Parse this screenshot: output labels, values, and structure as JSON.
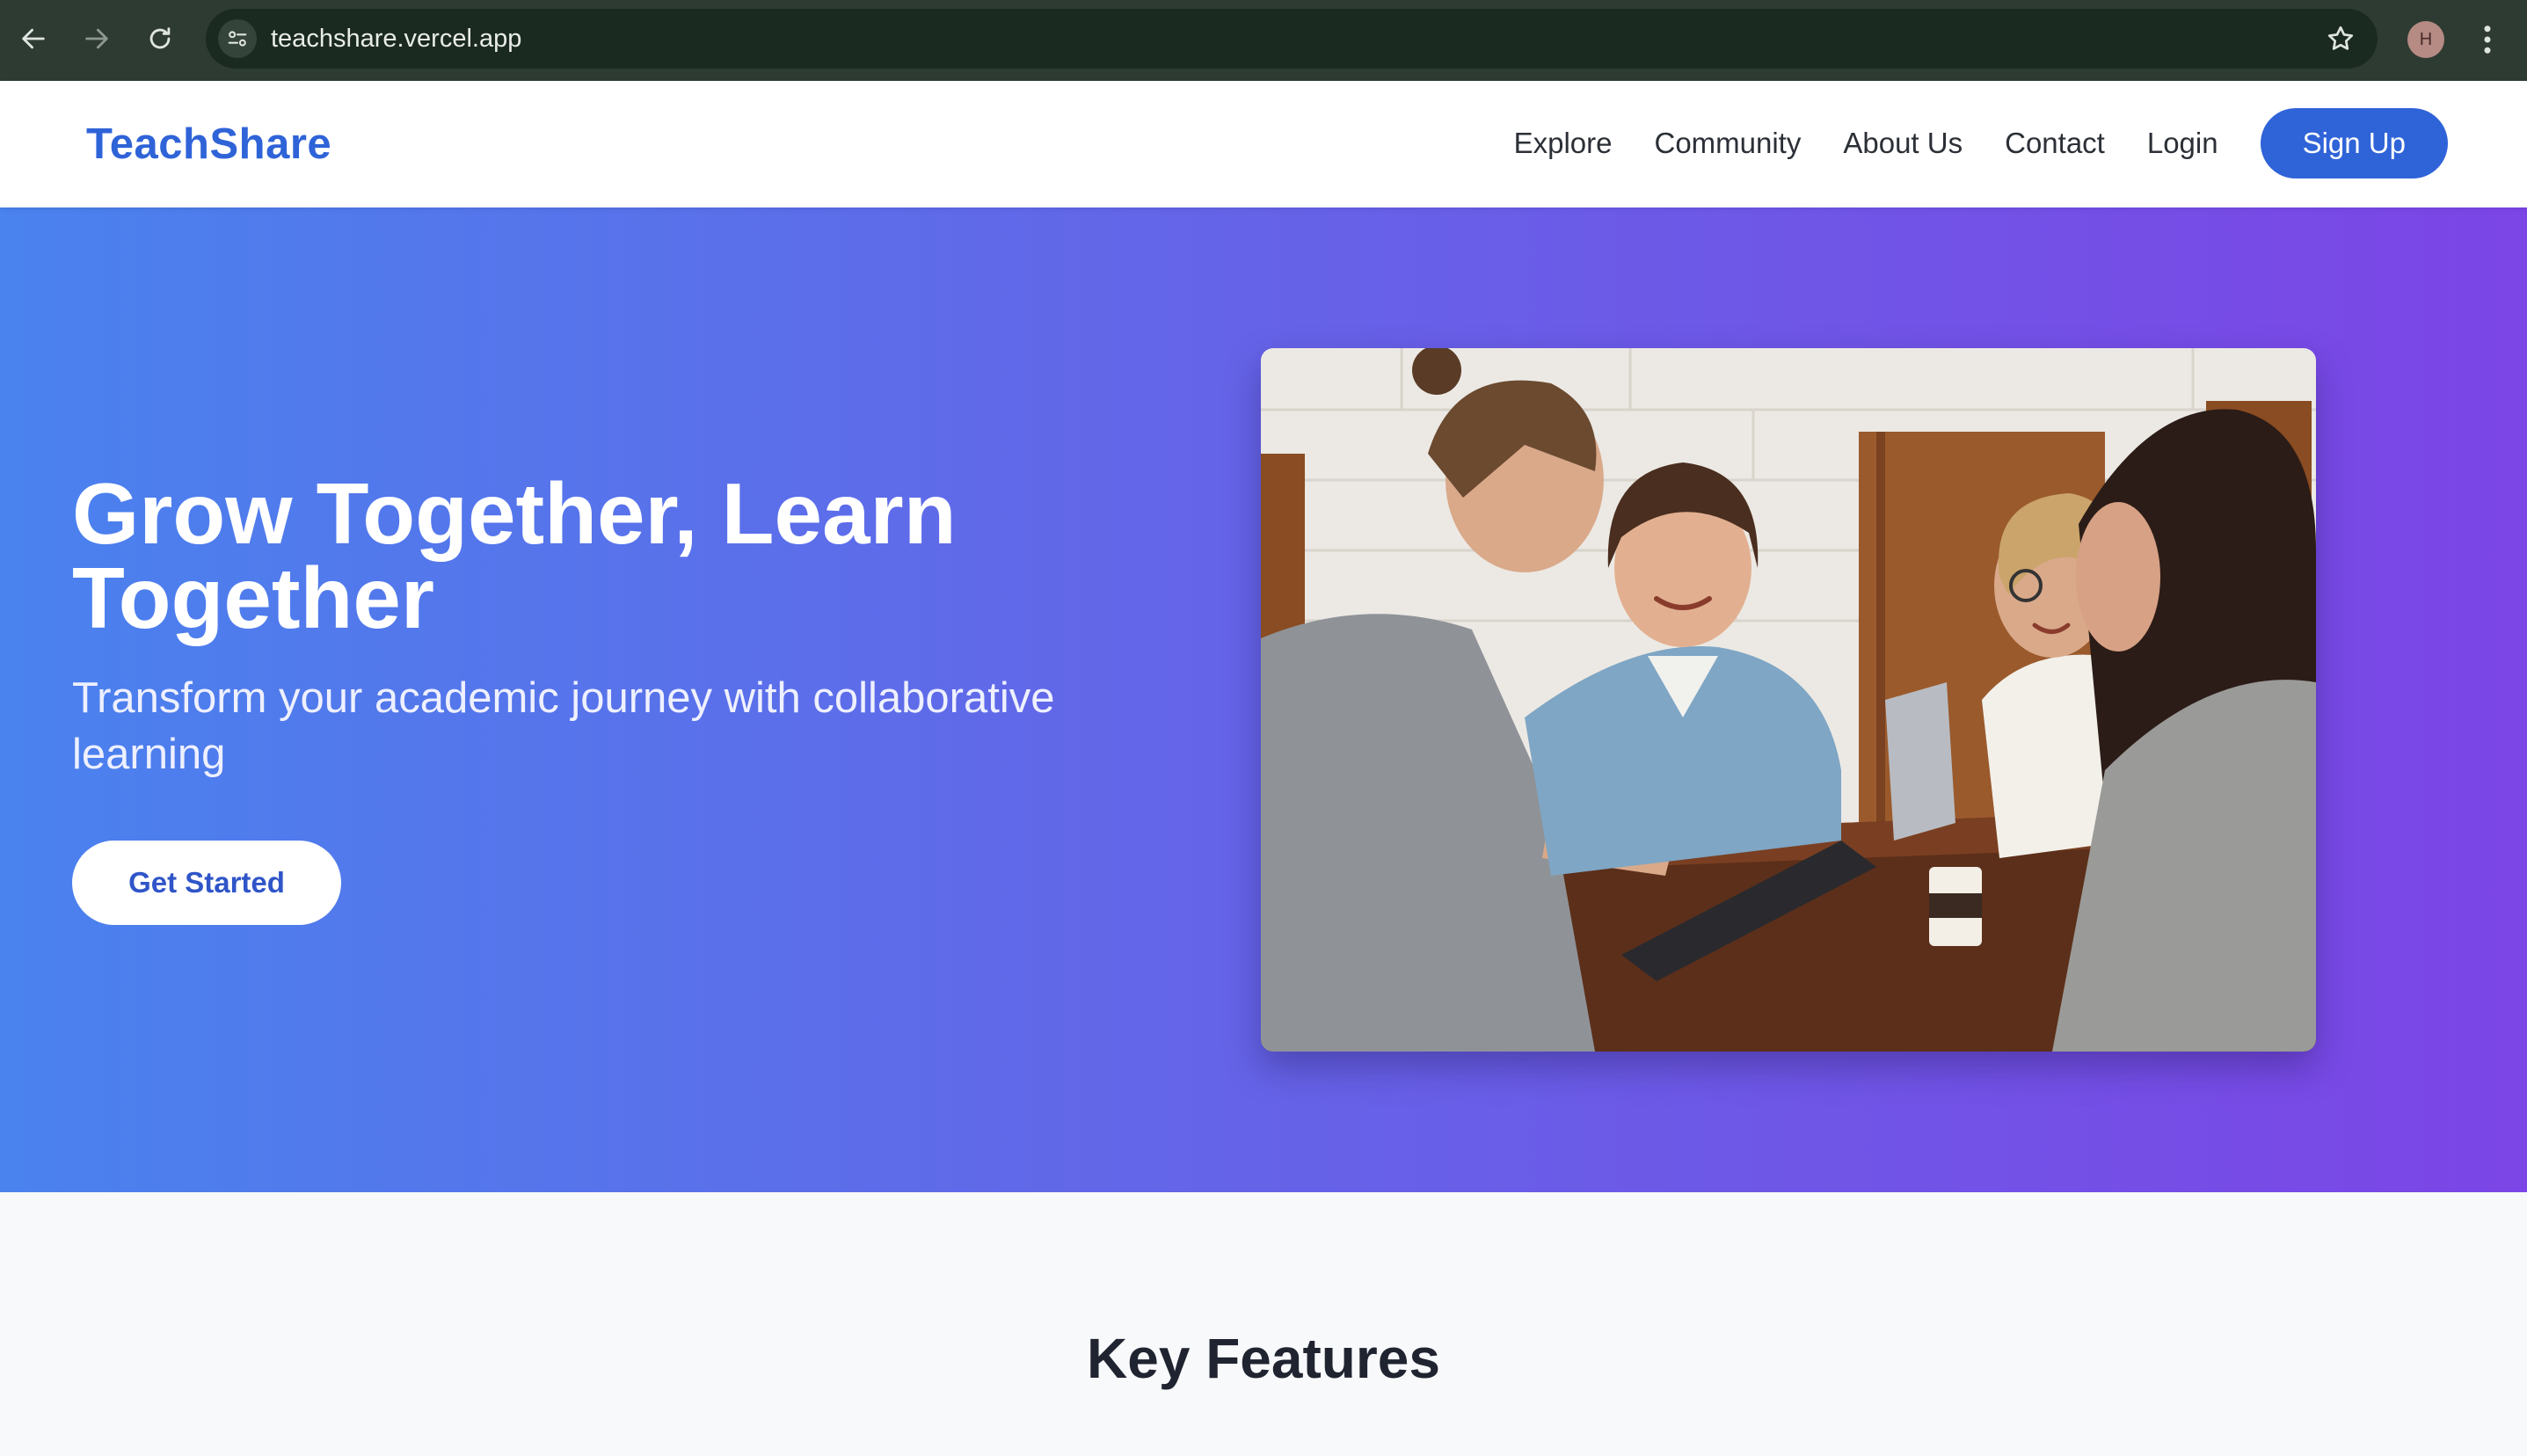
{
  "browser": {
    "url": "teachshare.vercel.app",
    "profile_initial": "H",
    "icons": [
      "back-icon",
      "forward-icon",
      "reload-icon",
      "site-info-icon",
      "bookmark-star-icon",
      "more-vertical-icon"
    ]
  },
  "header": {
    "brand": "TeachShare",
    "nav": [
      "Explore",
      "Community",
      "About Us",
      "Contact",
      "Login"
    ],
    "signup_label": "Sign Up"
  },
  "hero": {
    "title": "Grow Together, Learn Together",
    "subtitle": "Transform your academic journey with collaborative learning",
    "cta_label": "Get Started"
  },
  "features": {
    "title": "Key Features"
  },
  "colors": {
    "brand": "#2f63d8",
    "hero_gradient_start": "#4a82ee",
    "hero_gradient_end": "#7c45e6",
    "chrome": "#2e3b32"
  }
}
